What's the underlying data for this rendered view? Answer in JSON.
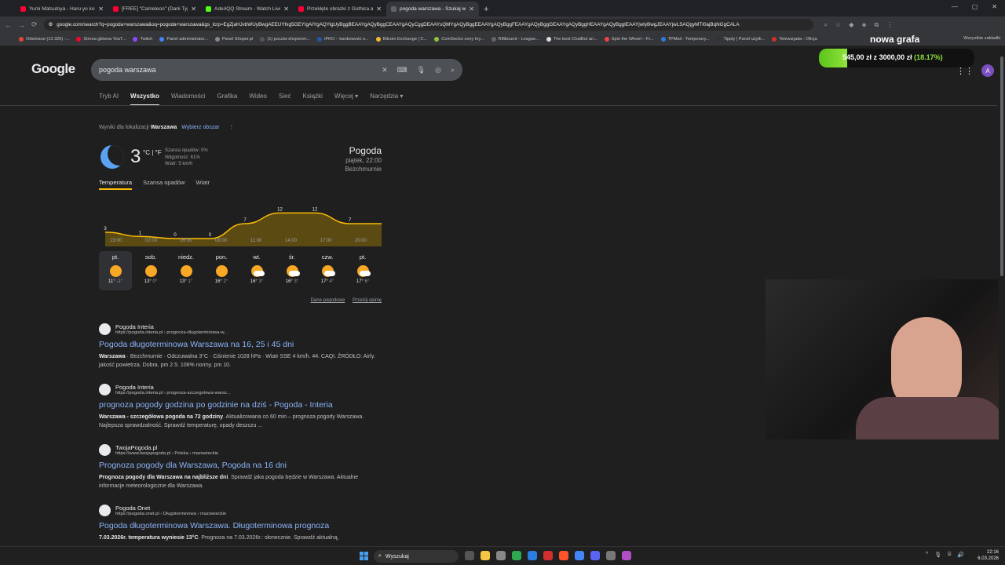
{
  "tabs": [
    {
      "title": "Yumi Matsutoya - Haru yo koi",
      "color": "#ff0033",
      "active": false
    },
    {
      "title": "[FREE] \"Cameleon\" (Dark Type",
      "color": "#ff0033",
      "active": false
    },
    {
      "title": "AderiQQ Stream - Watch Live o",
      "color": "#53fc18",
      "active": false
    },
    {
      "title": "Przeklęte obrazki z Gothica a t",
      "color": "#ff0033",
      "active": false
    },
    {
      "title": "pogoda warszawa - Szukaj w G",
      "color": "#5f6368",
      "active": true
    }
  ],
  "address": {
    "url": "google.com/search?q=pogoda+warszawa&oq=pogoda+warszawa&gs_lcrp=EgZjaHJvbWUyBwgAEEUYfxg5GEYIgAIYgAQYigUyBggBEAAYgAQyBggCEAAYgAQyCggDEAAYsQMYgAQyBggEEAAYgAQyBggFEAAYgAQyBggGEAAYgAQyBggHEAAYgAQyBggIEAAYjwIyBwgJEAAYjwLSAQgyMTI0ajBqNGgCALA"
  },
  "bookmarks": [
    "Odebrane (13 325) -...",
    "Strona główna YouT...",
    "Twitch",
    "Panel administrator...",
    "Panel Shoper.pl",
    "(1) poczta-shoperen...",
    "iPKO – bankowość e...",
    "Bitcoin Exchange | C...",
    "CoinGecko ceny kry...",
    "Riftbound - League...",
    "The best ChatBot an...",
    "Spin the Wheel – Fr...",
    "TPMail - Temporary...",
    "Tipply | Panel użytk...",
    "Telewizjada - Oficja"
  ],
  "bookmarks_all": "Wszystkie zakładki",
  "overlay": {
    "title": "nowa grafa",
    "amount": "545,00 zł",
    "of": "z",
    "goal": "3000,00 zł",
    "percent": "(18.17%)",
    "progress": 0.1817
  },
  "google": {
    "logo": "Google",
    "query": "pogoda warszawa",
    "avatar": "A",
    "nav": [
      "Tryb AI",
      "Wszystko",
      "Wiadomości",
      "Grafika",
      "Wideo",
      "Sieć",
      "Książki",
      "Więcej ▾",
      "Narzędzia ▾"
    ],
    "location_prefix": "Wyniki dla lokalizacji",
    "location": "Warszawa",
    "location_change": "Wybierz obszar"
  },
  "weather": {
    "temp": "3",
    "unit": "°C | °F",
    "precip": "Szansa opadów: 0%",
    "humidity": "Wilgotność: 61%",
    "wind": "Wiatr: 5 km/h",
    "title": "Pogoda",
    "datetime": "piątek, 22:00",
    "condition": "Bezchmurnie",
    "tabs": [
      "Temperatura",
      "Szansa opadów",
      "Wiatr"
    ],
    "footer_source": "Dane pogodowe",
    "footer_feedback": "Prześlij opinię",
    "days": [
      {
        "name": "pt.",
        "hi": "11°",
        "lo": "-1°",
        "cloud": false
      },
      {
        "name": "sob.",
        "hi": "13°",
        "lo": "0°",
        "cloud": false
      },
      {
        "name": "niedz.",
        "hi": "13°",
        "lo": "1°",
        "cloud": false
      },
      {
        "name": "pon.",
        "hi": "16°",
        "lo": "2°",
        "cloud": false
      },
      {
        "name": "wt.",
        "hi": "16°",
        "lo": "3°",
        "cloud": true
      },
      {
        "name": "śr.",
        "hi": "16°",
        "lo": "3°",
        "cloud": true
      },
      {
        "name": "czw.",
        "hi": "17°",
        "lo": "4°",
        "cloud": true
      },
      {
        "name": "pt.",
        "hi": "17°",
        "lo": "6°",
        "cloud": true
      }
    ]
  },
  "chart_data": {
    "type": "area",
    "categories": [
      "23:00",
      "02:00",
      "05:00",
      "08:00",
      "11:00",
      "14:00",
      "17:00",
      "20:00"
    ],
    "values": [
      3,
      1,
      0,
      0,
      7,
      12,
      12,
      7
    ],
    "ylim": [
      0,
      14
    ],
    "color": "#fbbc04"
  },
  "results": [
    {
      "site": "Pogoda Interia",
      "url": "https://pogoda.interia.pl › prognoza-dlugoterminowa-w...",
      "title": "Pogoda długoterminowa Warszawa na 16, 25 i 45 dni",
      "bold": "Warszawa",
      "snippet": " · Bezchmurnie · Odczuwalna 3°C · Ciśnienie 1028 hPa · Wiatr SSE 4 km/h. 44. CAQI. ŹRÓDŁO: Airly. jakość powietrza. Dobra. pm 2.5. 106% normy. pm 10."
    },
    {
      "site": "Pogoda Interia",
      "url": "https://pogoda.interia.pl › prognoza-szczegolowa-warsz...",
      "title": "prognoza pogody godzina po godzinie na dziś - Pogoda - Interia",
      "bold": "Warszawa - szczegółowa pogoda na 72 godziny",
      "snippet": ". Aktualizowana co 60 min – prognoza pogody Warszawa. Najlepsza sprawdzalność. Sprawdź temperaturę, opady deszczu ..."
    },
    {
      "site": "TwojaPogoda.pl",
      "url": "https://www.twojapogoda.pl › Polska › mazowieckie",
      "title": "Prognoza pogody dla Warszawa, Pogoda na 16 dni",
      "bold": "Prognoza pogody dla Warszawa na najbliższe dni",
      "snippet": ". Sprawdź jaka pogoda będzie w Warszawa. Aktualne informacje meteorologiczne dla Warszawa."
    },
    {
      "site": "Pogoda Onet",
      "url": "https://pogoda.onet.pl › Długoterminowa › mazowieckie",
      "title": "Pogoda długoterminowa Warszawa. Długoterminowa prognoza",
      "bold": "7.03.2026r. temperatura wyniesie 13°C",
      "snippet": ". Prognoza na 7.03.2026r.: słonecznie. Sprawdź aktualną,"
    }
  ],
  "taskbar": {
    "search": "Wyszukaj",
    "time": "22:16",
    "date": "6.03.2026"
  }
}
